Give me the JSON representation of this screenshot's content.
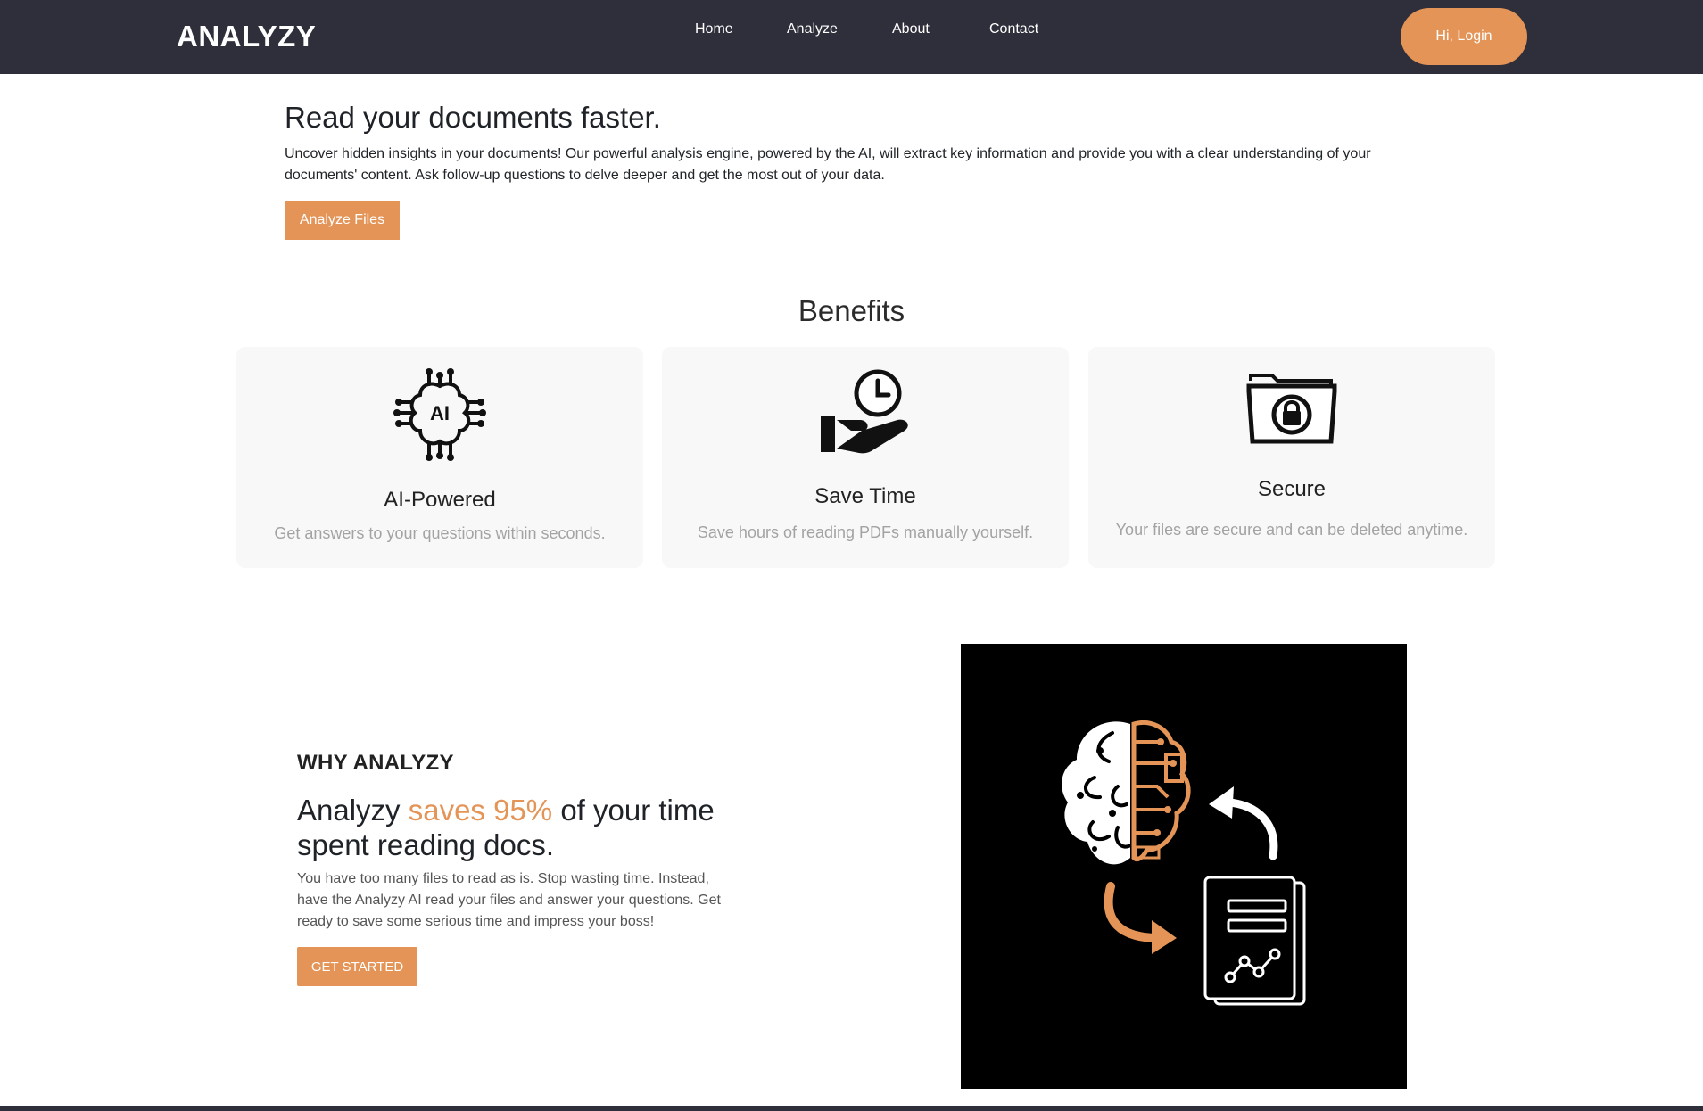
{
  "nav": {
    "brand": "ANALYZY",
    "links": [
      "Home",
      "Analyze",
      "About",
      "Contact"
    ],
    "login_label": "Hi, Login"
  },
  "hero": {
    "title": "Read your documents faster.",
    "text": "Uncover hidden insights in your documents! Our powerful analysis engine, powered by the AI, will extract key information and provide you with a clear understanding of your documents' content. Ask follow-up questions to delve deeper and get the most out of your data.",
    "button_label": "Analyze Files"
  },
  "benefits": {
    "title": "Benefits",
    "cards": [
      {
        "icon": "ai-brain-icon",
        "title": "AI-Powered",
        "text": "Get answers to your questions within seconds."
      },
      {
        "icon": "time-hand-icon",
        "title": "Save Time",
        "text": "Save hours of reading PDFs manually yourself."
      },
      {
        "icon": "secure-folder-icon",
        "title": "Secure",
        "text": "Your files are secure and can be deleted anytime."
      }
    ]
  },
  "why": {
    "label": "WHY ANALYZY",
    "headline_pre": "Analyzy ",
    "headline_highlight": "saves 95%",
    "headline_post": " of your time spent reading docs.",
    "text": "You have too many files to read as is. Stop wasting time. Instead, have the Analyzy AI read your files and answer your questions. Get ready to save some serious time and impress your boss!",
    "button_label": "GET STARTED"
  },
  "colors": {
    "accent": "#e39456",
    "nav_bg": "#2f2f3b",
    "card_bg": "#f8f8f8"
  }
}
